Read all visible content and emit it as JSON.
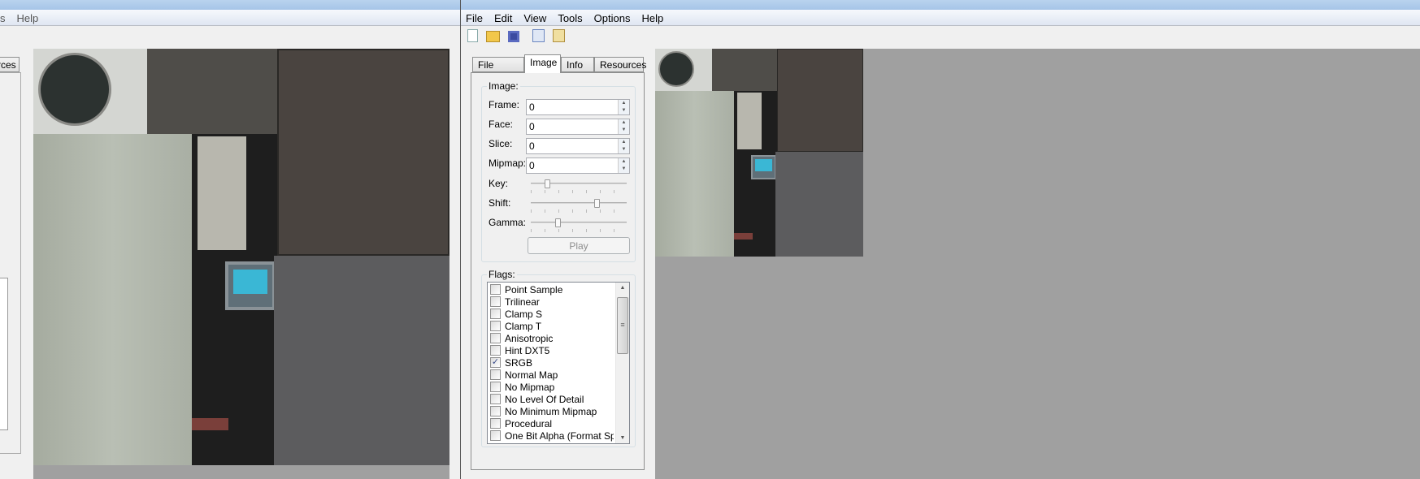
{
  "background_window": {
    "menu_partial": [
      "s",
      "Help"
    ],
    "tab_partial": "rces"
  },
  "window": {
    "menu": [
      "File",
      "Edit",
      "View",
      "Tools",
      "Options",
      "Help"
    ],
    "toolbar": [
      "new-file-icon",
      "open-folder-icon",
      "save-icon",
      "copy-icon",
      "paste-icon"
    ],
    "tabs": [
      {
        "label": "File System",
        "active": false
      },
      {
        "label": "Image",
        "active": true
      },
      {
        "label": "Info",
        "active": false
      },
      {
        "label": "Resources",
        "active": false
      }
    ],
    "image_group": {
      "title": "Image:",
      "frame_label": "Frame:",
      "frame_value": "0",
      "face_label": "Face:",
      "face_value": "0",
      "slice_label": "Slice:",
      "slice_value": "0",
      "mipmap_label": "Mipmap:",
      "mipmap_value": "0",
      "key_label": "Key:",
      "key_level": 0.15,
      "shift_label": "Shift:",
      "shift_level": 0.7,
      "gamma_label": "Gamma:",
      "gamma_level": 0.27,
      "play_label": "Play"
    },
    "flags_group": {
      "title": "Flags:",
      "flags": [
        {
          "label": "Point Sample",
          "checked": false
        },
        {
          "label": "Trilinear",
          "checked": false
        },
        {
          "label": "Clamp S",
          "checked": false
        },
        {
          "label": "Clamp T",
          "checked": false
        },
        {
          "label": "Anisotropic",
          "checked": false
        },
        {
          "label": "Hint DXT5",
          "checked": false
        },
        {
          "label": "SRGB",
          "checked": true
        },
        {
          "label": "Normal Map",
          "checked": false
        },
        {
          "label": "No Mipmap",
          "checked": false
        },
        {
          "label": "No Level Of Detail",
          "checked": false
        },
        {
          "label": "No Minimum Mipmap",
          "checked": false
        },
        {
          "label": "Procedural",
          "checked": false
        },
        {
          "label": "One Bit Alpha (Format Spec",
          "checked": false
        }
      ]
    }
  },
  "colors": {
    "viewport_bg": "#a0a0a0",
    "panel_bg": "#f0f0f0"
  }
}
